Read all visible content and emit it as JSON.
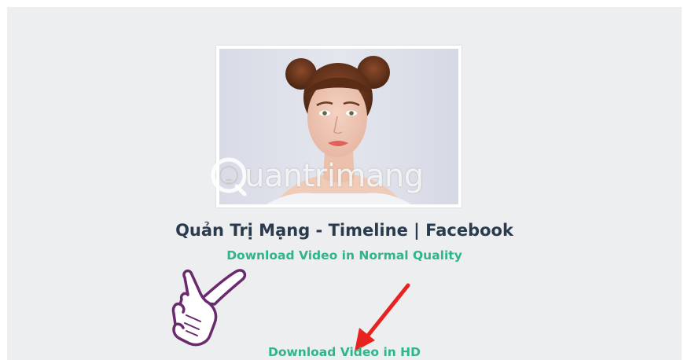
{
  "video": {
    "title": "Quản Trị Mạng - Timeline | Facebook",
    "watermark": "uantrimang"
  },
  "links": {
    "normal_quality": "Download Video in Normal Quality",
    "hd": "Download Video in HD"
  },
  "colors": {
    "link": "#2fb48c",
    "title": "#2b3b4e",
    "panel_bg": "#eceef0",
    "arrow": "#e8231f",
    "hand_outline": "#6a2a6e"
  },
  "icons": {
    "pointer": "pointing-hand-icon",
    "arrow": "red-arrow-icon"
  }
}
